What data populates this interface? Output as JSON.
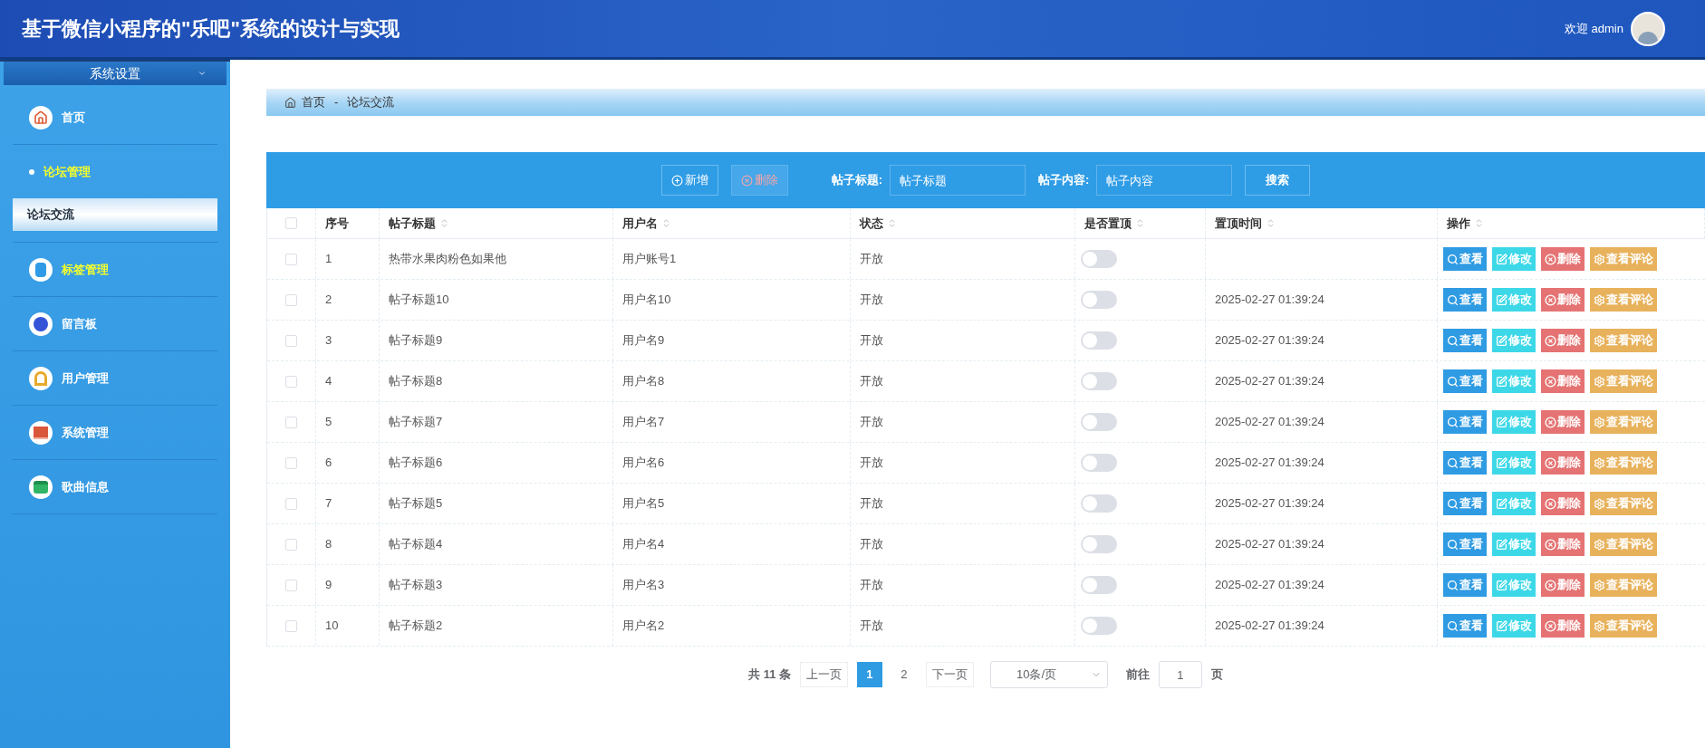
{
  "header": {
    "title": "基于微信小程序的\"乐吧\"系统的设计与实现",
    "welcome": "欢迎 admin"
  },
  "sidebar": {
    "title": "系统设置",
    "items": [
      {
        "label": "首页",
        "kind": "icon",
        "selected": false,
        "highlighted": false
      },
      {
        "label": "论坛管理",
        "kind": "bullet",
        "selected": false,
        "highlighted": true,
        "expanded": true,
        "children": [
          {
            "label": "论坛交流",
            "selected": true
          }
        ]
      },
      {
        "label": "标签管理",
        "kind": "icon",
        "selected": false,
        "highlighted": true
      },
      {
        "label": "留言板",
        "kind": "icon",
        "selected": false,
        "highlighted": false
      },
      {
        "label": "用户管理",
        "kind": "icon",
        "selected": false,
        "highlighted": false
      },
      {
        "label": "系统管理",
        "kind": "icon",
        "selected": false,
        "highlighted": false
      },
      {
        "label": "歌曲信息",
        "kind": "icon",
        "selected": false,
        "highlighted": false
      }
    ]
  },
  "breadcrumb": {
    "home": "首页",
    "separator": "-",
    "current": "论坛交流"
  },
  "toolbar": {
    "buttons": [
      {
        "label": "新增",
        "disabled": false
      },
      {
        "label": "删除",
        "disabled": true
      }
    ],
    "fields": [
      {
        "label": "帖子标题:",
        "placeholder": "帖子标题"
      },
      {
        "label": "帖子内容:",
        "placeholder": "帖子内容"
      }
    ],
    "search": "搜索"
  },
  "table": {
    "select_all_checked": false,
    "columns": [
      {
        "label": "序号",
        "sortable": false
      },
      {
        "label": "帖子标题",
        "sortable": true
      },
      {
        "label": "用户名",
        "sortable": true
      },
      {
        "label": "状态",
        "sortable": true
      },
      {
        "label": "是否置顶",
        "sortable": true
      },
      {
        "label": "置顶时间",
        "sortable": true
      },
      {
        "label": "操作",
        "sortable": true
      }
    ],
    "rows": [
      {
        "checked": false,
        "index": "1",
        "title": "热带水果肉粉色如果他",
        "user": "用户账号1",
        "status": "开放",
        "pinned": false,
        "actions": [
          "查看",
          "修改",
          "删除",
          "查看评论"
        ]
      },
      {
        "checked": false,
        "index": "2",
        "title": "帖子标题10",
        "user": "用户名10",
        "status": "开放",
        "pinned": false,
        "pinned_time": "2025-02-27 01:39:24",
        "actions": [
          "查看",
          "修改",
          "删除",
          "查看评论"
        ]
      },
      {
        "checked": false,
        "index": "3",
        "title": "帖子标题9",
        "user": "用户名9",
        "status": "开放",
        "pinned": false,
        "pinned_time": "2025-02-27 01:39:24",
        "actions": [
          "查看",
          "修改",
          "删除",
          "查看评论"
        ]
      },
      {
        "checked": false,
        "index": "4",
        "title": "帖子标题8",
        "user": "用户名8",
        "status": "开放",
        "pinned": false,
        "pinned_time": "2025-02-27 01:39:24",
        "actions": [
          "查看",
          "修改",
          "删除",
          "查看评论"
        ]
      },
      {
        "checked": false,
        "index": "5",
        "title": "帖子标题7",
        "user": "用户名7",
        "status": "开放",
        "pinned": false,
        "pinned_time": "2025-02-27 01:39:24",
        "actions": [
          "查看",
          "修改",
          "删除",
          "查看评论"
        ]
      },
      {
        "checked": false,
        "index": "6",
        "title": "帖子标题6",
        "user": "用户名6",
        "status": "开放",
        "pinned": false,
        "pinned_time": "2025-02-27 01:39:24",
        "actions": [
          "查看",
          "修改",
          "删除",
          "查看评论"
        ]
      },
      {
        "checked": false,
        "index": "7",
        "title": "帖子标题5",
        "user": "用户名5",
        "status": "开放",
        "pinned": false,
        "pinned_time": "2025-02-27 01:39:24",
        "actions": [
          "查看",
          "修改",
          "删除",
          "查看评论"
        ]
      },
      {
        "checked": false,
        "index": "8",
        "title": "帖子标题4",
        "user": "用户名4",
        "status": "开放",
        "pinned": false,
        "pinned_time": "2025-02-27 01:39:24",
        "actions": [
          "查看",
          "修改",
          "删除",
          "查看评论"
        ]
      },
      {
        "checked": false,
        "index": "9",
        "title": "帖子标题3",
        "user": "用户名3",
        "status": "开放",
        "pinned": false,
        "pinned_time": "2025-02-27 01:39:24",
        "actions": [
          "查看",
          "修改",
          "删除",
          "查看评论"
        ]
      },
      {
        "checked": false,
        "index": "10",
        "title": "帖子标题2",
        "user": "用户名2",
        "status": "开放",
        "pinned": false,
        "pinned_time": "2025-02-27 01:39:24",
        "actions": [
          "查看",
          "修改",
          "删除",
          "查看评论"
        ]
      }
    ]
  },
  "pagination": {
    "total": "共 11 条",
    "prev": "上一页",
    "pages": [
      {
        "label": "1",
        "selected": true
      },
      {
        "label": "2",
        "selected": false
      }
    ],
    "next": "下一页",
    "page_size": "10条/页",
    "goto_label": "前往",
    "goto_value": "1",
    "goto_suffix": "页"
  }
}
